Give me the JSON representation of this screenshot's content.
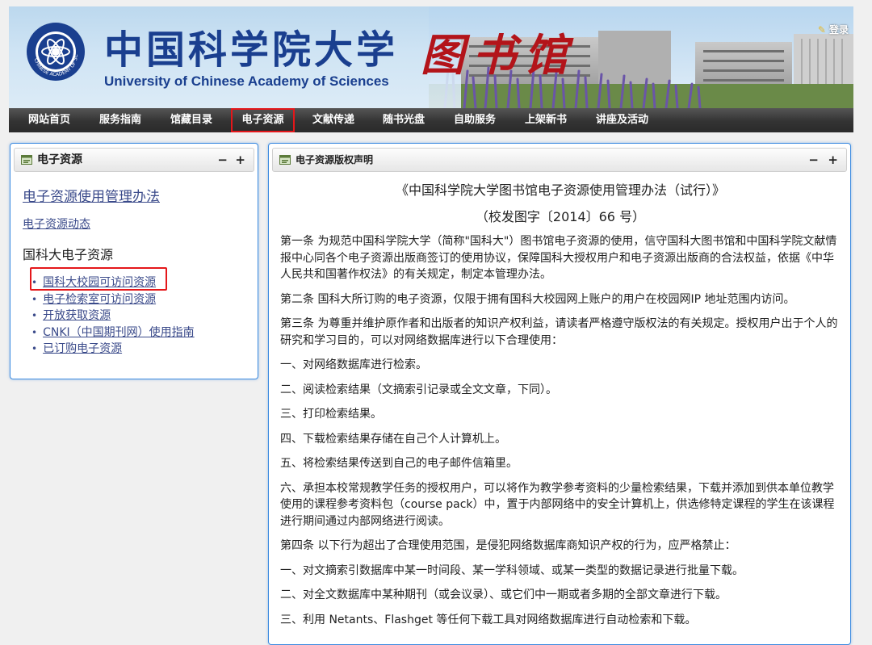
{
  "banner": {
    "title_cn": "中国科学院大学",
    "title_en": "University of Chinese Academy of Sciences",
    "library_text": "图书馆",
    "seal_text": "CHINESE ACADEMY OF SCIENCES",
    "login_label": "登录"
  },
  "nav": {
    "items": [
      {
        "label": "网站首页"
      },
      {
        "label": "服务指南"
      },
      {
        "label": "馆藏目录"
      },
      {
        "label": "电子资源"
      },
      {
        "label": "文献传递"
      },
      {
        "label": "随书光盘"
      },
      {
        "label": "自助服务"
      },
      {
        "label": "上架新书"
      },
      {
        "label": "讲座及活动"
      }
    ],
    "active_index": 3
  },
  "left_panel": {
    "title": "电子资源",
    "collapse_label": "−",
    "expand_label": "+",
    "link_main": "电子资源使用管理办法",
    "link_news": "电子资源动态",
    "section_title": "国科大电子资源",
    "items": [
      {
        "label": "国科大校园可访问资源"
      },
      {
        "label": "电子检索室可访问资源"
      },
      {
        "label": "开放获取资源"
      },
      {
        "label": "CNKI（中国期刊网）使用指南"
      },
      {
        "label": "已订购电子资源"
      }
    ],
    "highlighted_index": 0
  },
  "right_panel": {
    "title": "电子资源版权声明",
    "collapse_label": "−",
    "expand_label": "+",
    "doc_title": "《中国科学院大学图书馆电子资源使用管理办法（试行）》",
    "doc_number": "（校发图字〔2014〕66 号）",
    "paragraphs": [
      "第一条 为规范中国科学院大学（简称\"国科大\"）图书馆电子资源的使用，信守国科大图书馆和中国科学院文献情报中心同各个电子资源出版商签订的使用协议，保障国科大授权用户和电子资源出版商的合法权益，依据《中华人民共和国著作权法》的有关规定，制定本管理办法。",
      "第二条 国科大所订购的电子资源，仅限于拥有国科大校园网上账户的用户在校园网IP 地址范围内访问。",
      "第三条 为尊重并维护原作者和出版者的知识产权利益，请读者严格遵守版权法的有关规定。授权用户出于个人的研究和学习目的，可以对网络数据库进行以下合理使用：",
      "一、对网络数据库进行检索。",
      "二、阅读检索结果（文摘索引记录或全文文章，下同）。",
      "三、打印检索结果。",
      "四、下载检索结果存储在自己个人计算机上。",
      "五、将检索结果传送到自己的电子邮件信箱里。",
      "六、承担本校常规教学任务的授权用户，可以将作为教学参考资料的少量检索结果，下载并添加到供本单位教学使用的课程参考资料包（course pack）中，置于内部网络中的安全计算机上，供选修特定课程的学生在该课程进行期间通过内部网络进行阅读。",
      "第四条 以下行为超出了合理使用范围，是侵犯网络数据库商知识产权的行为，应严格禁止：",
      "一、对文摘索引数据库中某一时间段、某一学科领域、或某一类型的数据记录进行批量下载。",
      "二、对全文数据库中某种期刊（或会议录）、或它们中一期或者多期的全部文章进行下载。",
      "三、利用 Netants、Flashget 等任何下载工具对网络数据库进行自动检索和下载。"
    ]
  },
  "colors": {
    "brand_blue": "#1a3f8f",
    "library_red": "#b3141a",
    "nav_bg": "#333333",
    "highlight_red": "#e4171a",
    "panel_border": "#3d8be0",
    "link": "#3a4a8a"
  }
}
